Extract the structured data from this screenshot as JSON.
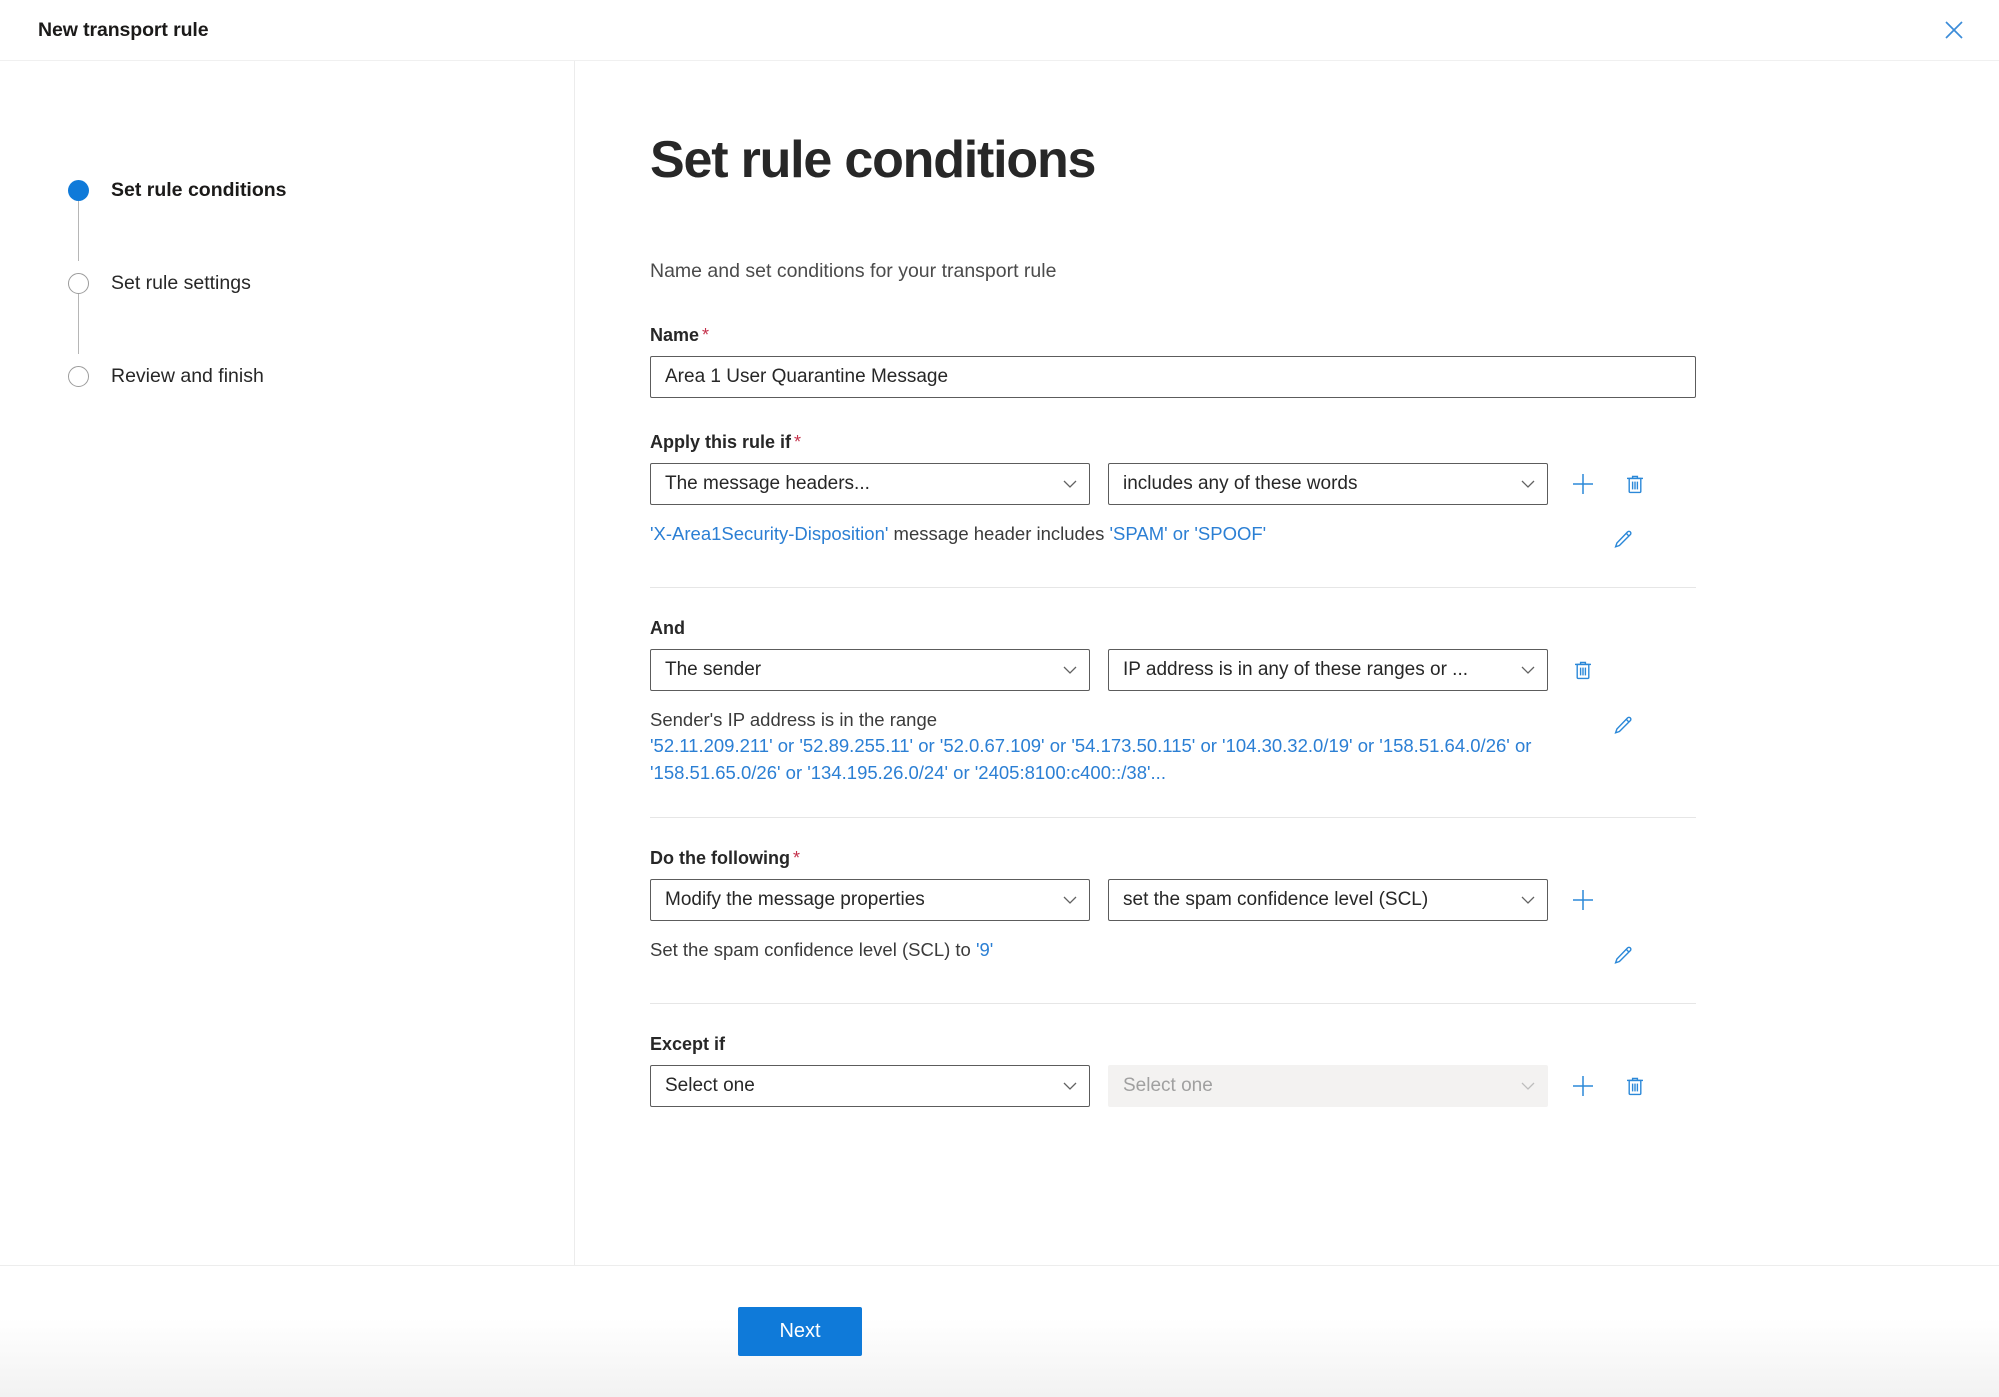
{
  "window": {
    "title": "New transport rule",
    "close_icon": "close-icon"
  },
  "sidebar": {
    "steps": [
      {
        "label": "Set rule conditions",
        "state": "current"
      },
      {
        "label": "Set rule settings",
        "state": "idle"
      },
      {
        "label": "Review and finish",
        "state": "idle"
      }
    ]
  },
  "main": {
    "title": "Set rule conditions",
    "subtitle": "Name and set conditions for your transport rule",
    "name_field": {
      "label": "Name",
      "required": "*",
      "value": "Area 1 User Quarantine Message",
      "placeholder": ""
    },
    "sections": [
      {
        "label": "Apply this rule if",
        "required": "*",
        "left_select": "The message headers...",
        "right_select": "includes any of these words",
        "description_prefix": "'X-Area1Security-Disposition'",
        "description_middle": "message header includes",
        "description_value": "'SPAM' or 'SPOOF'"
      },
      {
        "label": "And",
        "required": "",
        "left_select": "The sender",
        "right_select": "IP address is in any of these ranges or ...",
        "description_prefix": "Sender's IP address is in the range",
        "description_value": "'52.11.209.211' or '52.89.255.11' or '52.0.67.109' or '54.173.50.115' or '104.30.32.0/19' or '158.51.64.0/26' or '158.51.65.0/26' or '134.195.26.0/24' or '2405:8100:c400::/38'..."
      },
      {
        "label": "Do the following",
        "required": "*",
        "left_select": "Modify the message properties",
        "right_select": "set the spam confidence level (SCL)",
        "description_prefix": "Set the spam confidence level (SCL) to",
        "description_value": "'9'"
      },
      {
        "label": "Except if",
        "required": "",
        "left_select": "Select one",
        "right_select": "Select one"
      }
    ]
  },
  "footer": {
    "next_label": "Next"
  },
  "colors": {
    "accent": "#0f7ad9",
    "link": "#2b7fd4",
    "icon": "#2b88d8",
    "required": "#c4314b"
  }
}
